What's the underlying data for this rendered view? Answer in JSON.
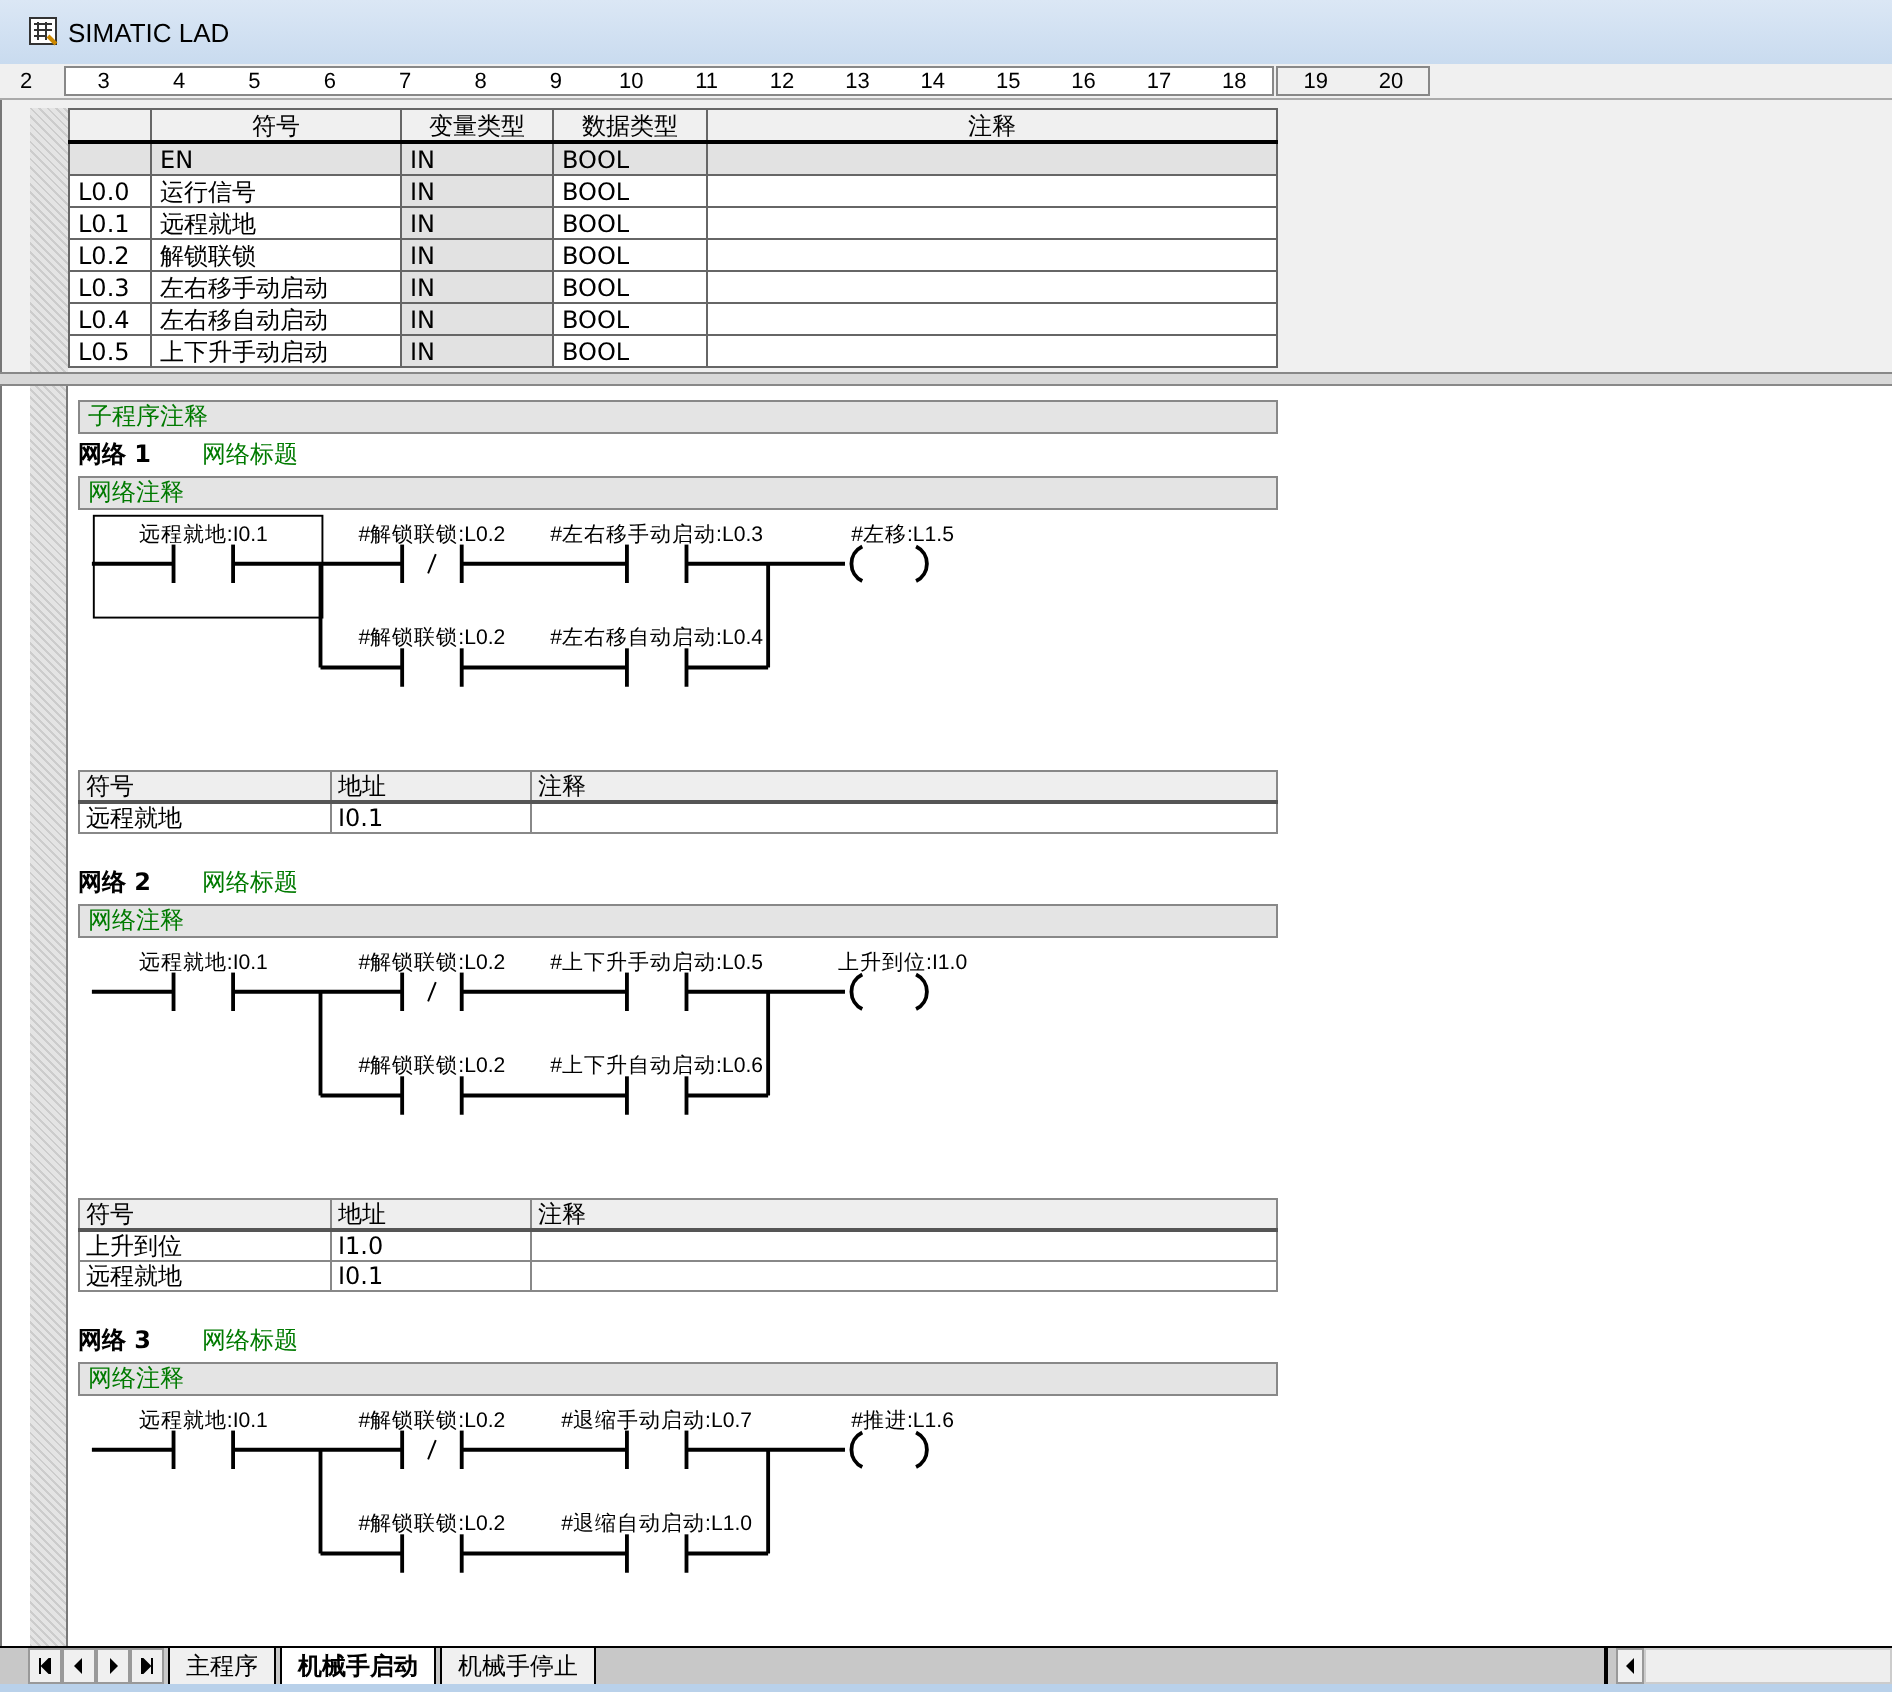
{
  "window": {
    "title": "SIMATIC LAD"
  },
  "ruler": {
    "first": "2",
    "page_marks": [
      "3",
      "4",
      "5",
      "6",
      "7",
      "8",
      "9",
      "10",
      "11",
      "12",
      "13",
      "14",
      "15",
      "16",
      "17",
      "18"
    ],
    "overflow_marks": [
      "19",
      "20"
    ]
  },
  "variable_table": {
    "columns": [
      "符号",
      "变量类型",
      "数据类型",
      "注释"
    ],
    "rows": [
      {
        "symbol": "EN",
        "var_type": "IN",
        "data_type": "BOOL",
        "editable": false
      },
      {
        "address": "L0.0",
        "symbol": "运行信号",
        "var_type": "IN",
        "data_type": "BOOL",
        "editable": true
      },
      {
        "address": "L0.1",
        "symbol": "远程就地",
        "var_type": "IN",
        "data_type": "BOOL",
        "editable": true
      },
      {
        "address": "L0.2",
        "symbol": "解锁联锁",
        "var_type": "IN",
        "data_type": "BOOL",
        "editable": true
      },
      {
        "address": "L0.3",
        "symbol": "左右移手动启动",
        "var_type": "IN",
        "data_type": "BOOL",
        "editable": true
      },
      {
        "address": "L0.4",
        "symbol": "左右移自动启动",
        "var_type": "IN",
        "data_type": "BOOL",
        "editable": true
      },
      {
        "address": "L0.5",
        "symbol": "上下升手动启动",
        "var_type": "IN",
        "data_type": "BOOL",
        "editable": true
      }
    ]
  },
  "program_comment": "子程序注释",
  "networks": [
    {
      "label": "网络",
      "number": "1",
      "title": "网络标题",
      "comment": "网络注释",
      "input": {
        "label": "远程就地:I0.1",
        "kind": "no",
        "selected": true
      },
      "branches": [
        [
          {
            "label": "#解锁联锁:L0.2",
            "kind": "nc",
            "selected": false
          },
          {
            "label": "#左右移手动启动:L0.3",
            "kind": "no",
            "selected": false
          }
        ],
        [
          {
            "label": "#解锁联锁:L0.2",
            "kind": "no",
            "selected": false
          },
          {
            "label": "#左右移自动启动:L0.4",
            "kind": "no",
            "selected": false
          }
        ]
      ],
      "coil": {
        "label": "#左移:L1.5",
        "kind": "coil",
        "selected": false
      },
      "symbols": {
        "columns": [
          "符号",
          "地址",
          "注释"
        ],
        "rows": [
          {
            "symbol": "远程就地",
            "address": "I0.1"
          }
        ]
      }
    },
    {
      "label": "网络",
      "number": "2",
      "title": "网络标题",
      "comment": "网络注释",
      "input": {
        "label": "远程就地:I0.1",
        "kind": "no",
        "selected": false
      },
      "branches": [
        [
          {
            "label": "#解锁联锁:L0.2",
            "kind": "nc",
            "selected": false
          },
          {
            "label": "#上下升手动启动:L0.5",
            "kind": "no",
            "selected": false
          }
        ],
        [
          {
            "label": "#解锁联锁:L0.2",
            "kind": "no",
            "selected": false
          },
          {
            "label": "#上下升自动启动:L0.6",
            "kind": "no",
            "selected": false
          }
        ]
      ],
      "coil": {
        "label": "上升到位:I1.0",
        "kind": "coil",
        "selected": false
      },
      "symbols": {
        "columns": [
          "符号",
          "地址",
          "注释"
        ],
        "rows": [
          {
            "symbol": "上升到位",
            "address": "I1.0"
          },
          {
            "symbol": "远程就地",
            "address": "I0.1"
          }
        ]
      }
    },
    {
      "label": "网络",
      "number": "3",
      "title": "网络标题",
      "comment": "网络注释",
      "input": {
        "label": "远程就地:I0.1",
        "kind": "no",
        "selected": false
      },
      "branches": [
        [
          {
            "label": "#解锁联锁:L0.2",
            "kind": "nc",
            "selected": false
          },
          {
            "label": "#退缩手动启动:L0.7",
            "kind": "no",
            "selected": false
          }
        ],
        [
          {
            "label": "#解锁联锁:L0.2",
            "kind": "no",
            "selected": false
          },
          {
            "label": "#退缩自动启动:L1.0",
            "kind": "no",
            "selected": false
          }
        ]
      ],
      "coil": {
        "label": "#推进:L1.6",
        "kind": "coil",
        "selected": false
      }
    }
  ],
  "tabs": [
    {
      "label": "主程序",
      "selected": false
    },
    {
      "label": "机械手启动",
      "selected": true
    },
    {
      "label": "机械手停止",
      "selected": false
    }
  ]
}
